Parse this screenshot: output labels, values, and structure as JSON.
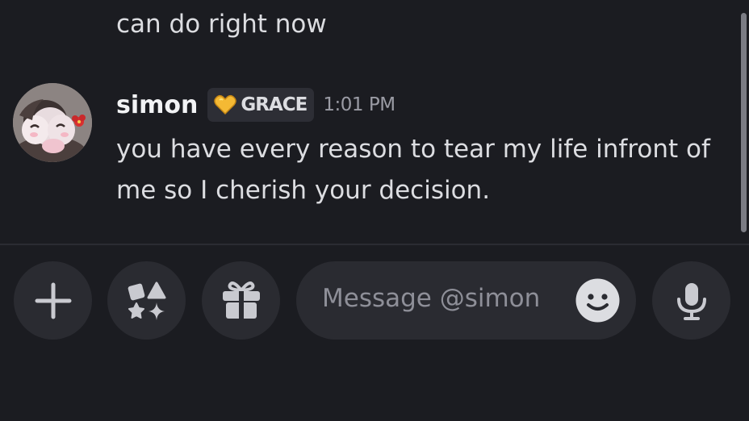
{
  "chat": {
    "previous_message_tail": "can do right now",
    "message": {
      "username": "simon",
      "tag": {
        "icon": "heart-icon",
        "color": "#f4b934",
        "label": "GRACE"
      },
      "timestamp": "1:01 PM",
      "text": "you have every reason to tear my life infront of me so I cherish your decision."
    }
  },
  "composer": {
    "buttons": [
      {
        "icon": "plus-icon"
      },
      {
        "icon": "apps-icon"
      },
      {
        "icon": "gift-icon"
      },
      {
        "icon": "microphone-icon"
      }
    ],
    "placeholder": "Message @simon",
    "emoji_icon": "emoji-icon"
  },
  "colors": {
    "background": "#1b1c21",
    "surface": "#2a2b31",
    "text": "#dcdde1",
    "muted": "#9a9ba4"
  }
}
